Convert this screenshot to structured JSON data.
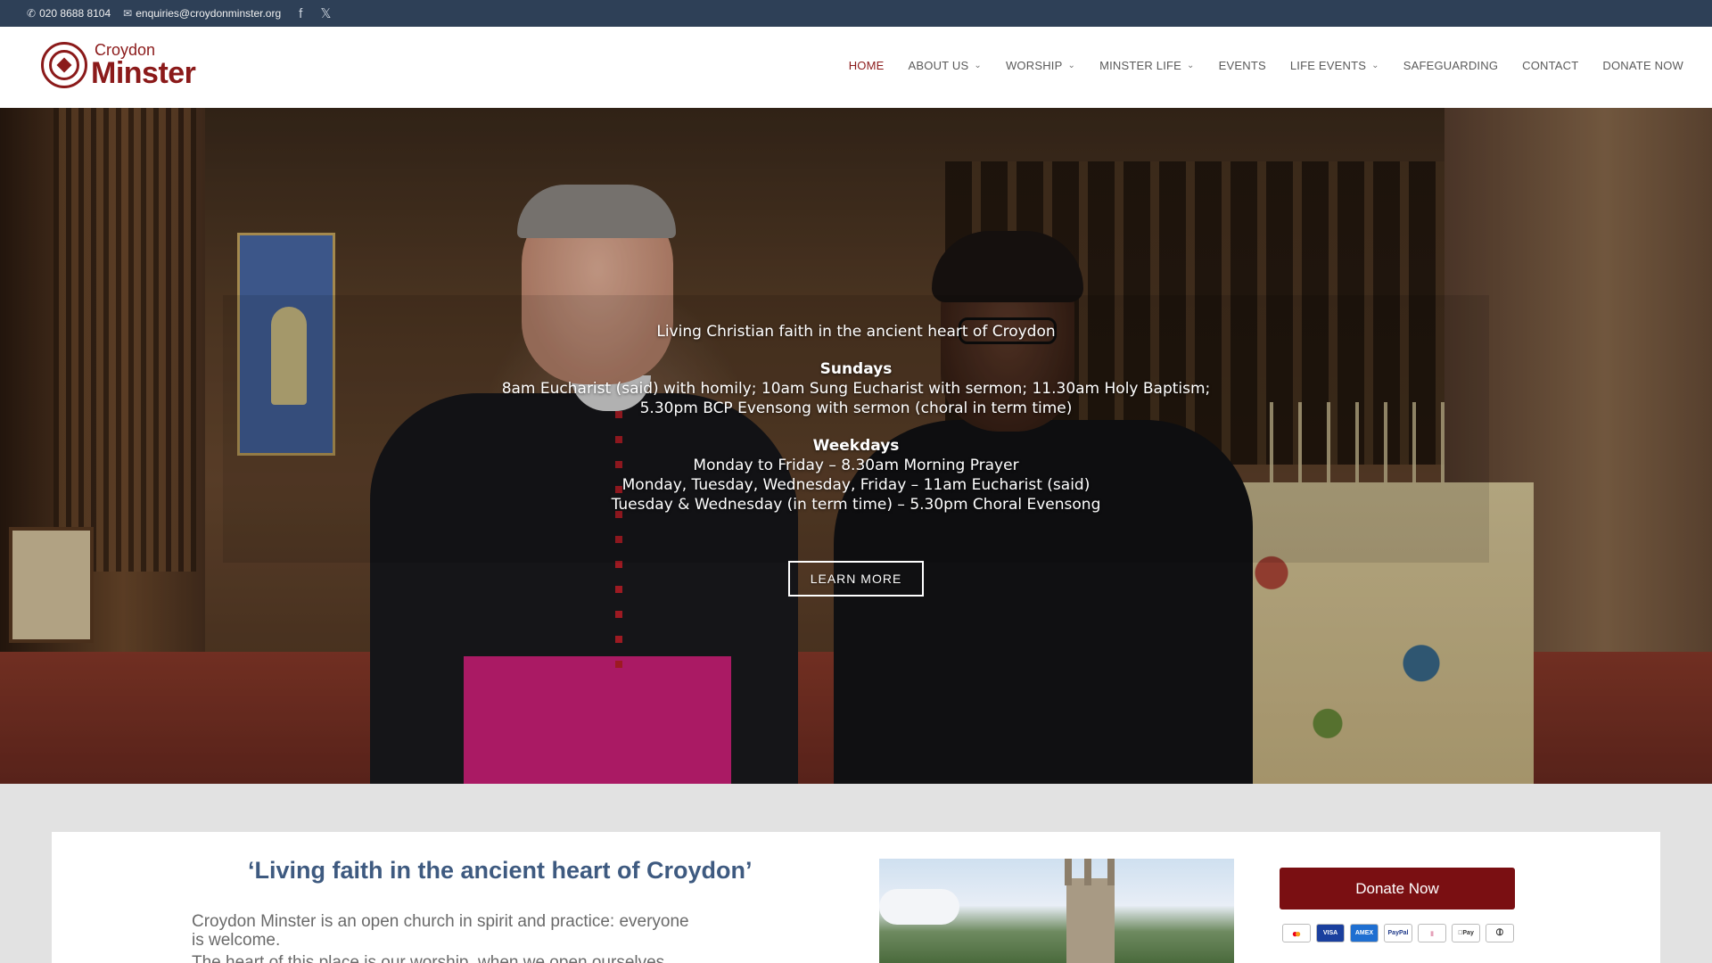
{
  "topbar": {
    "phone": "020 8688 8104",
    "email": "enquiries@croydonminster.org",
    "facebook_icon": "facebook-icon",
    "x_icon": "x-icon"
  },
  "logo": {
    "small": "Croydon",
    "big": "Minster"
  },
  "nav": {
    "items": [
      {
        "label": "HOME",
        "active": true,
        "dropdown": false
      },
      {
        "label": "ABOUT US",
        "active": false,
        "dropdown": true
      },
      {
        "label": "WORSHIP",
        "active": false,
        "dropdown": true
      },
      {
        "label": "MINSTER LIFE",
        "active": false,
        "dropdown": true
      },
      {
        "label": "EVENTS",
        "active": false,
        "dropdown": false
      },
      {
        "label": "LIFE EVENTS",
        "active": false,
        "dropdown": true
      },
      {
        "label": "SAFEGUARDING",
        "active": false,
        "dropdown": false
      },
      {
        "label": "CONTACT",
        "active": false,
        "dropdown": false
      },
      {
        "label": "DONATE NOW",
        "active": false,
        "dropdown": false
      }
    ]
  },
  "hero": {
    "tagline": "Living Christian faith in the ancient heart of Croydon",
    "sundays_heading": "Sundays",
    "sundays_text": "8am Eucharist (said) with homily; 10am Sung Eucharist with sermon; 11.30am Holy Baptism; 5.30pm BCP Evensong with sermon (choral in term time)",
    "weekdays_heading": "Weekdays",
    "weekdays_line1": "Monday to Friday – 8.30am Morning Prayer",
    "weekdays_line2": "Monday, Tuesday, Wednesday, Friday – 11am Eucharist (said)",
    "weekdays_line3": "Tuesday & Wednesday (in term time) – 5.30pm Choral Evensong",
    "button": "LEARN MORE"
  },
  "content": {
    "title": "‘Living faith in the ancient heart of Croydon’",
    "para1": "Croydon Minster is an open church in spirit and practice: everyone is welcome.",
    "para2": "The heart of this place is our worship, when we open ourselves"
  },
  "donate": {
    "button": "Donate Now",
    "payment_methods": [
      "mastercard",
      "VISA",
      "AMEX",
      "PayPal",
      "",
      "Pay",
      ""
    ]
  },
  "colors": {
    "accent": "#8b1a1a",
    "topbar": "#2e4057",
    "donate": "#7a0f12",
    "title": "#3e5a80"
  }
}
